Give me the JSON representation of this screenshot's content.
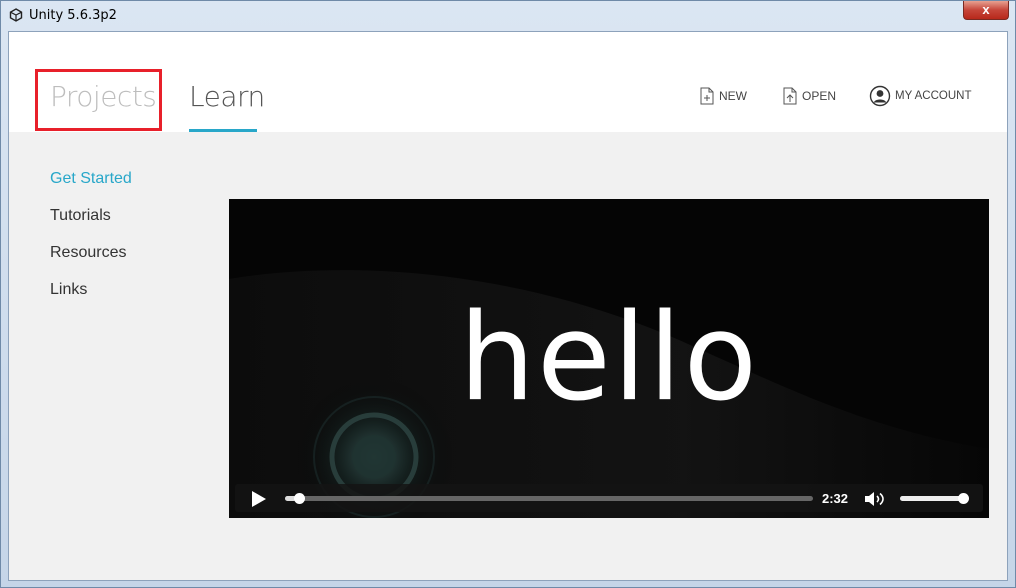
{
  "window": {
    "title": "Unity 5.6.3p2",
    "close_label": "x"
  },
  "header": {
    "tabs": [
      {
        "label": "Projects",
        "active": false
      },
      {
        "label": "Learn",
        "active": true
      }
    ],
    "buttons": {
      "new_label": "NEW",
      "open_label": "OPEN",
      "account_label": "MY ACCOUNT"
    }
  },
  "sidebar": {
    "items": [
      {
        "label": "Get Started",
        "active": true
      },
      {
        "label": "Tutorials",
        "active": false
      },
      {
        "label": "Resources",
        "active": false
      },
      {
        "label": "Links",
        "active": false
      }
    ]
  },
  "video": {
    "overlay_text": "hello",
    "duration": "2:32",
    "progress": 0.02,
    "volume": 1.0
  },
  "colors": {
    "accent": "#28a7c9",
    "highlight": "#e8202a"
  },
  "icons": [
    "unity-logo-icon",
    "new-file-icon",
    "open-file-icon",
    "account-icon",
    "play-icon",
    "volume-icon"
  ]
}
